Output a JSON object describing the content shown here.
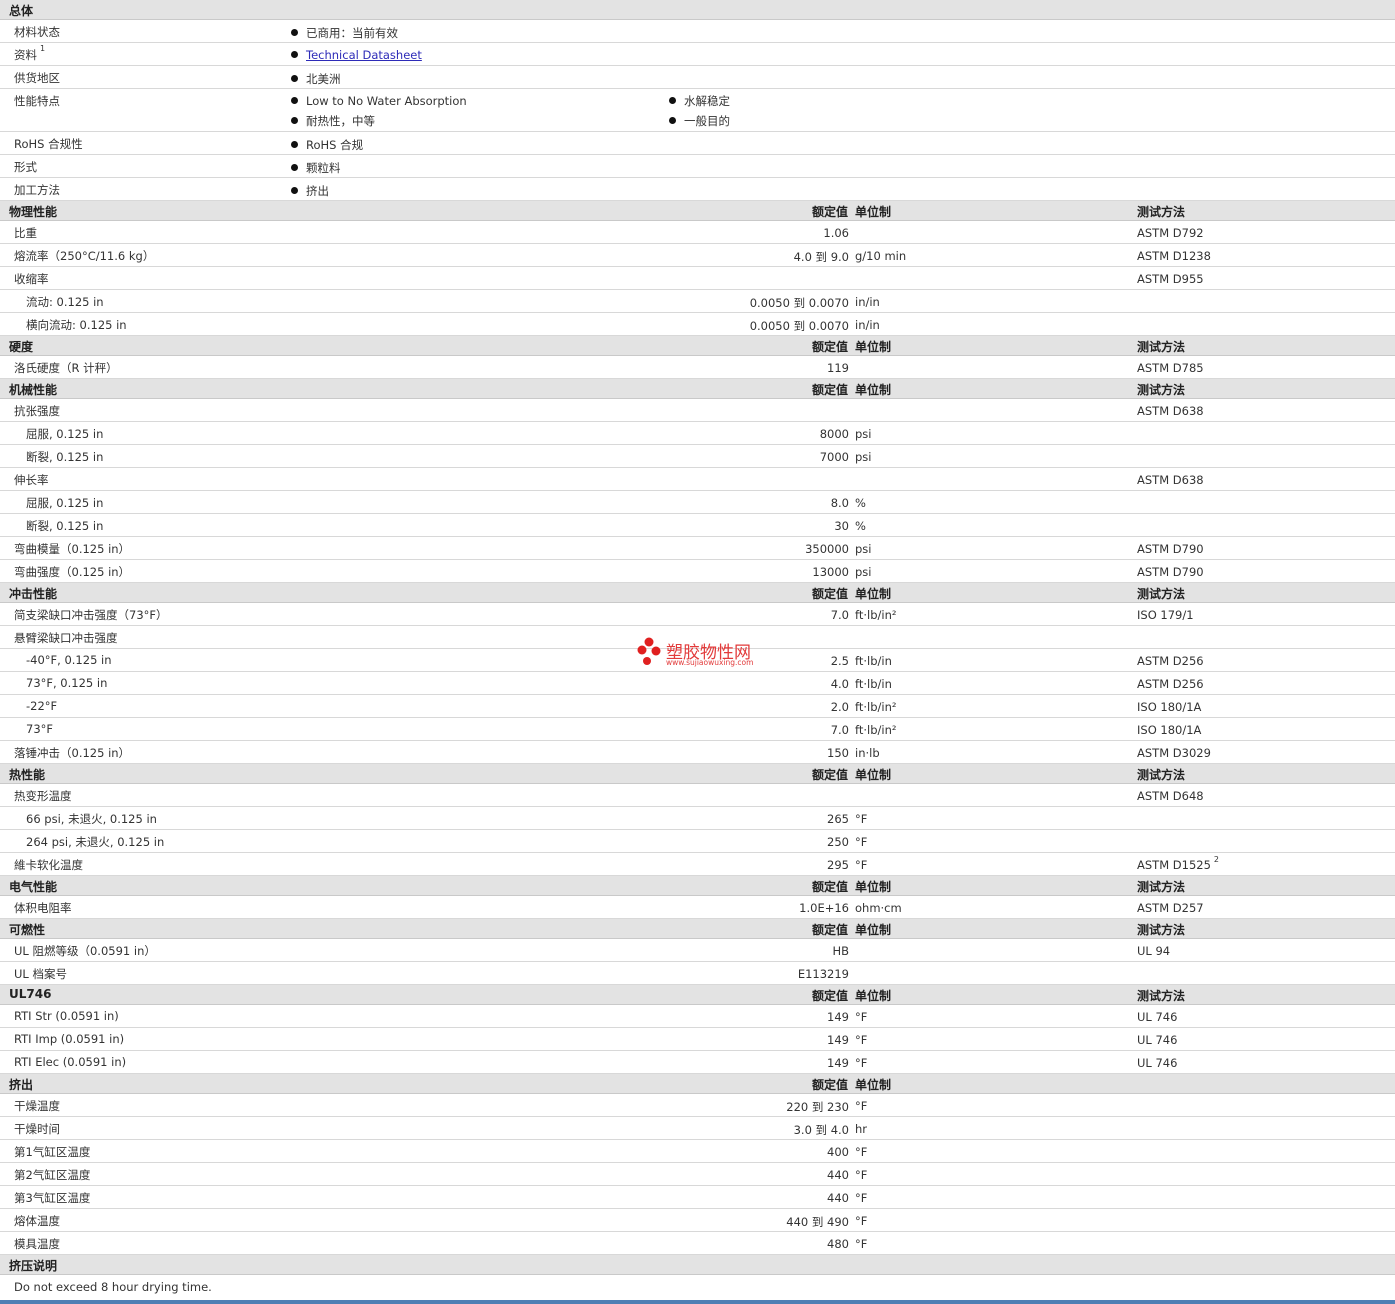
{
  "general": {
    "title": "总体",
    "rows": [
      {
        "label": "材料状态",
        "values": [
          "已商用：当前有效"
        ]
      },
      {
        "label": "资料",
        "sup": "1",
        "link": "Technical Datasheet"
      },
      {
        "label": "供货地区",
        "values": [
          "北美洲"
        ]
      },
      {
        "label": "性能特点",
        "values": [
          "Low to No Water Absorption",
          "水解稳定",
          "耐热性，中等",
          "一般目的"
        ]
      },
      {
        "label": "RoHS 合规性",
        "values": [
          "RoHS 合规"
        ]
      },
      {
        "label": "形式",
        "values": [
          "颗粒料"
        ]
      },
      {
        "label": "加工方法",
        "values": [
          "挤出"
        ]
      }
    ]
  },
  "headers": {
    "value": "额定值",
    "unit": "单位制",
    "method": "测试方法"
  },
  "sections": [
    {
      "title": "物理性能",
      "rows": [
        {
          "label": "比重",
          "value": "1.06",
          "unit": "",
          "method": "ASTM D792"
        },
        {
          "label": "熔流率（250°C/11.6 kg）",
          "value": "4.0 到  9.0",
          "unit": "g/10 min",
          "method": "ASTM D1238"
        },
        {
          "label": "收缩率",
          "value": "",
          "unit": "",
          "method": "ASTM D955"
        },
        {
          "label": "流动: 0.125 in",
          "sub": true,
          "value": "0.0050 到  0.0070",
          "unit": "in/in",
          "method": ""
        },
        {
          "label": "横向流动: 0.125 in",
          "sub": true,
          "value": "0.0050 到  0.0070",
          "unit": "in/in",
          "method": ""
        }
      ]
    },
    {
      "title": "硬度",
      "rows": [
        {
          "label": "洛氏硬度（R 计秤）",
          "value": "119",
          "unit": "",
          "method": "ASTM D785"
        }
      ]
    },
    {
      "title": "机械性能",
      "rows": [
        {
          "label": "抗张强度",
          "value": "",
          "unit": "",
          "method": "ASTM D638"
        },
        {
          "label": "屈服, 0.125 in",
          "sub": true,
          "value": "8000",
          "unit": "psi",
          "method": ""
        },
        {
          "label": "断裂, 0.125 in",
          "sub": true,
          "value": "7000",
          "unit": "psi",
          "method": ""
        },
        {
          "label": "伸长率",
          "value": "",
          "unit": "",
          "method": "ASTM D638"
        },
        {
          "label": "屈服, 0.125 in",
          "sub": true,
          "value": "8.0",
          "unit": "%",
          "method": ""
        },
        {
          "label": "断裂, 0.125 in",
          "sub": true,
          "value": "30",
          "unit": "%",
          "method": ""
        },
        {
          "label": "弯曲模量（0.125 in）",
          "value": "350000",
          "unit": "psi",
          "method": "ASTM D790"
        },
        {
          "label": "弯曲强度（0.125 in）",
          "value": "13000",
          "unit": "psi",
          "method": "ASTM D790"
        }
      ]
    },
    {
      "title": "冲击性能",
      "rows": [
        {
          "label": "简支梁缺口冲击强度（73°F）",
          "value": "7.0",
          "unit": "ft·lb/in²",
          "method": "ISO 179/1"
        },
        {
          "label": "悬臂梁缺口冲击强度",
          "value": "",
          "unit": "",
          "method": ""
        },
        {
          "label": "-40°F, 0.125 in",
          "sub": true,
          "value": "2.5",
          "unit": "ft·lb/in",
          "method": "ASTM D256"
        },
        {
          "label": "73°F, 0.125 in",
          "sub": true,
          "value": "4.0",
          "unit": "ft·lb/in",
          "method": "ASTM D256"
        },
        {
          "label": "-22°F",
          "sub": true,
          "value": "2.0",
          "unit": "ft·lb/in²",
          "method": "ISO 180/1A"
        },
        {
          "label": "73°F",
          "sub": true,
          "value": "7.0",
          "unit": "ft·lb/in²",
          "method": "ISO 180/1A"
        },
        {
          "label": "落锤冲击（0.125 in）",
          "value": "150",
          "unit": "in·lb",
          "method": "ASTM D3029"
        }
      ]
    },
    {
      "title": "热性能",
      "rows": [
        {
          "label": "热变形温度",
          "value": "",
          "unit": "",
          "method": "ASTM D648"
        },
        {
          "label": "66 psi, 未退火, 0.125 in",
          "sub": true,
          "value": "265",
          "unit": "°F",
          "method": ""
        },
        {
          "label": "264 psi, 未退火, 0.125 in",
          "sub": true,
          "value": "250",
          "unit": "°F",
          "method": ""
        },
        {
          "label": "維卡软化温度",
          "value": "295",
          "unit": "°F",
          "method": "ASTM D1525",
          "sup": "2"
        }
      ]
    },
    {
      "title": "电气性能",
      "rows": [
        {
          "label": "体积电阻率",
          "value": "1.0E+16",
          "unit": "ohm·cm",
          "method": "ASTM D257"
        }
      ]
    },
    {
      "title": "可燃性",
      "rows": [
        {
          "label": "UL 阻燃等级（0.0591 in）",
          "value": "HB",
          "unit": "",
          "method": "UL 94"
        },
        {
          "label": "UL 档案号",
          "value": "E113219",
          "unit": "",
          "method": ""
        }
      ]
    },
    {
      "title": "UL746",
      "rows": [
        {
          "label": "RTI Str (0.0591 in)",
          "value": "149",
          "unit": "°F",
          "method": "UL 746"
        },
        {
          "label": "RTI Imp (0.0591 in)",
          "value": "149",
          "unit": "°F",
          "method": "UL 746"
        },
        {
          "label": "RTI Elec (0.0591 in)",
          "value": "149",
          "unit": "°F",
          "method": "UL 746"
        }
      ]
    },
    {
      "title": "挤出",
      "noMethod": true,
      "rows": [
        {
          "label": "干燥温度",
          "value": "220 到  230",
          "unit": "°F",
          "method": ""
        },
        {
          "label": "干燥时间",
          "value": "3.0 到  4.0",
          "unit": "hr",
          "method": ""
        },
        {
          "label": "第1气缸区温度",
          "value": "400",
          "unit": "°F",
          "method": ""
        },
        {
          "label": "第2气缸区温度",
          "value": "440",
          "unit": "°F",
          "method": ""
        },
        {
          "label": "第3气缸区温度",
          "value": "440",
          "unit": "°F",
          "method": ""
        },
        {
          "label": "熔体温度",
          "value": "440 到  490",
          "unit": "°F",
          "method": ""
        },
        {
          "label": "模具温度",
          "value": "480",
          "unit": "°F",
          "method": ""
        }
      ]
    }
  ],
  "notes": {
    "title": "挤压说明",
    "text": "Do not exceed 8 hour drying time."
  },
  "watermark": {
    "title": "塑胶物性网",
    "url": "www.sujiaowuxing.com"
  }
}
